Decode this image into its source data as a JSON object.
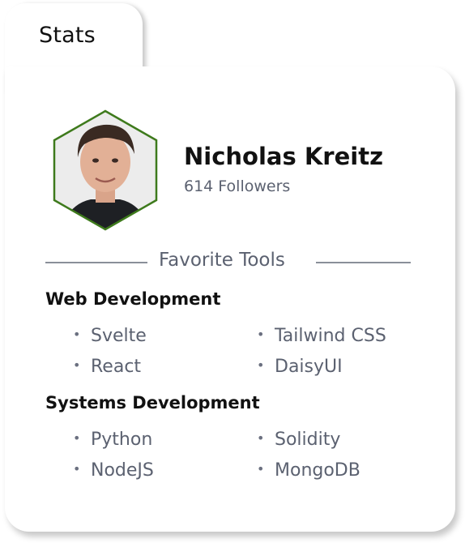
{
  "tab": {
    "label": "Stats"
  },
  "profile": {
    "name": "Nicholas Kreitz",
    "followers": "614 Followers",
    "avatar_border_color": "#3e7a1c"
  },
  "divider": {
    "label": "Favorite Tools"
  },
  "sections": [
    {
      "title": "Web Development",
      "tools": [
        "Svelte",
        "Tailwind CSS",
        "React",
        "DaisyUI"
      ]
    },
    {
      "title": "Systems Development",
      "tools": [
        "Python",
        "Solidity",
        "NodeJS",
        "MongoDB"
      ]
    }
  ],
  "colors": {
    "text_primary": "#111111",
    "text_muted": "#5b6170",
    "card_bg": "#ffffff"
  },
  "icons": {
    "bullet": "bullet-dot"
  }
}
